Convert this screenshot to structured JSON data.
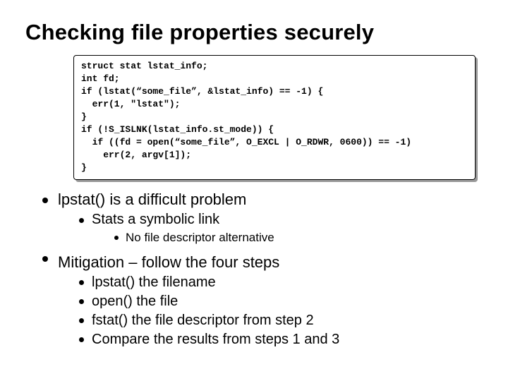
{
  "title": "Checking file properties securely",
  "code": {
    "l1": "struct stat lstat_info;",
    "l2": "int fd;",
    "l3": "if (lstat(“some_file”, &lstat_info) == -1) {",
    "l4": "  err(1, \"lstat\");",
    "l5": "}",
    "l6": "if (!S_ISLNK(lstat_info.st_mode)) {",
    "l7": "  if ((fd = open(“some_file”, O_EXCL | O_RDWR, 0600)) == -1)",
    "l8": "    err(2, argv[1]);",
    "l9": "}"
  },
  "bullets": {
    "b1": "lpstat() is a difficult problem",
    "b1_s1": "Stats a symbolic link",
    "b1_s1_s1": "No file descriptor alternative",
    "b2": "Mitigation – follow the four steps",
    "b2_s1": "lpstat() the filename",
    "b2_s2": "open() the file",
    "b2_s3": "fstat() the file descriptor from step 2",
    "b2_s4": "Compare the results from steps 1 and 3"
  }
}
